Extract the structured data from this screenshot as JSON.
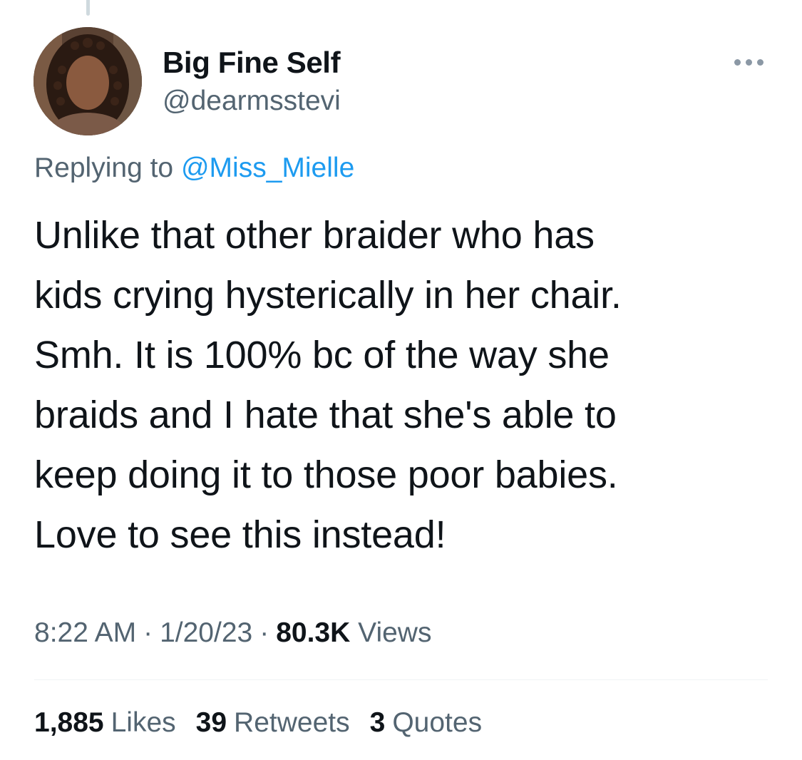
{
  "author": {
    "display_name": "Big Fine Self",
    "handle": "@dearmsstevi"
  },
  "reply": {
    "prefix": "Replying to",
    "mention": "@Miss_Mielle"
  },
  "tweet": {
    "text": "Unlike that other braider who has\nkids crying hysterically in her chair.\nSmh. It is 100% bc of the way she\nbraids and I hate that she's able to\nkeep doing it to those poor babies.\nLove to see this instead!"
  },
  "meta": {
    "time": "8:22 AM",
    "separator": "·",
    "date": "1/20/23",
    "views_count": "80.3K",
    "views_label": "Views"
  },
  "stats": {
    "likes_count": "1,885",
    "likes_label": "Likes",
    "retweets_count": "39",
    "retweets_label": "Retweets",
    "quotes_count": "3",
    "quotes_label": "Quotes"
  },
  "icons": {
    "more": "more-horizontal-icon"
  },
  "colors": {
    "text": "#0f1419",
    "secondary": "#536471",
    "link": "#1d9bf0",
    "divider": "#eff3f4"
  }
}
